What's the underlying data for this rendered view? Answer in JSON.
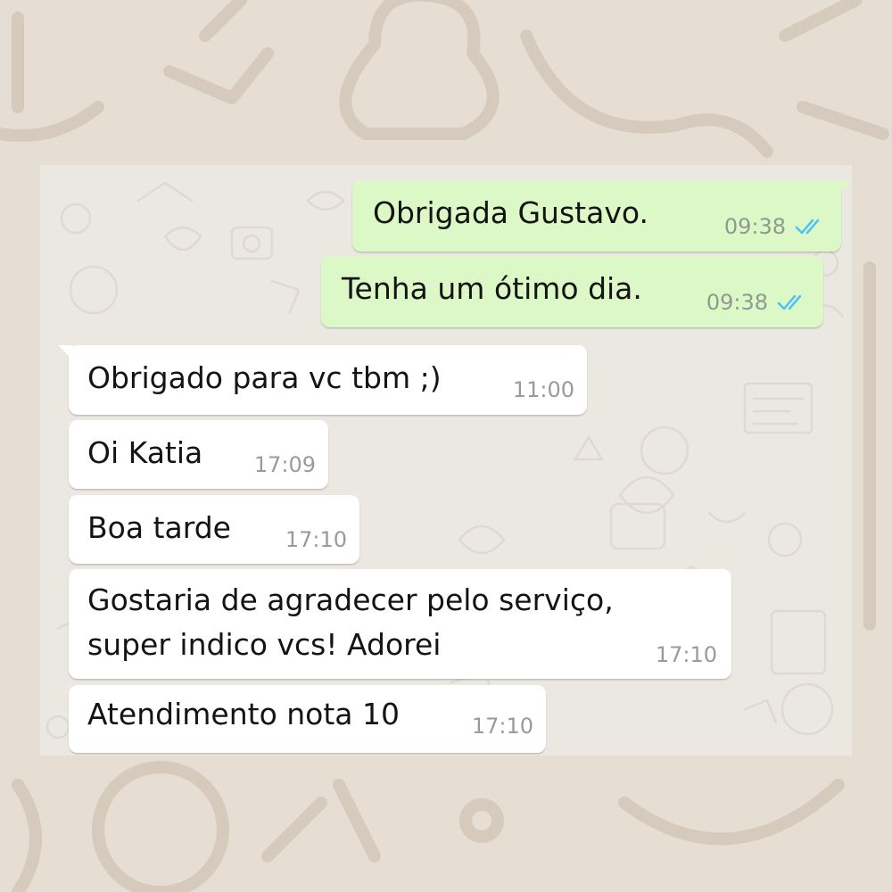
{
  "conversation": {
    "messages": [
      {
        "direction": "outgoing",
        "text": "Obrigada Gustavo.",
        "time": "09:38",
        "status": "read",
        "status_icon": "double-check-icon"
      },
      {
        "direction": "outgoing",
        "text": "Tenha um ótimo dia.",
        "time": "09:38",
        "status": "read",
        "status_icon": "double-check-icon"
      },
      {
        "direction": "incoming",
        "text": "Obrigado para vc tbm ;)",
        "time": "11:00"
      },
      {
        "direction": "incoming",
        "text": "Oi Katia",
        "time": "17:09"
      },
      {
        "direction": "incoming",
        "text": "Boa tarde",
        "time": "17:10"
      },
      {
        "direction": "incoming",
        "text": "Gostaria de agradecer pelo serviço,\nsuper indico vcs! Adorei",
        "time": "17:10"
      },
      {
        "direction": "incoming",
        "text": "Atendimento nota 10",
        "time": "17:10"
      }
    ]
  },
  "colors": {
    "outgoing_bubble": "#dcf8c6",
    "incoming_bubble": "#ffffff",
    "chat_background": "#ebe7e1",
    "outer_background": "#e6ddd3",
    "read_ticks": "#4fc3f7",
    "timestamp": "#9a9a9a"
  }
}
